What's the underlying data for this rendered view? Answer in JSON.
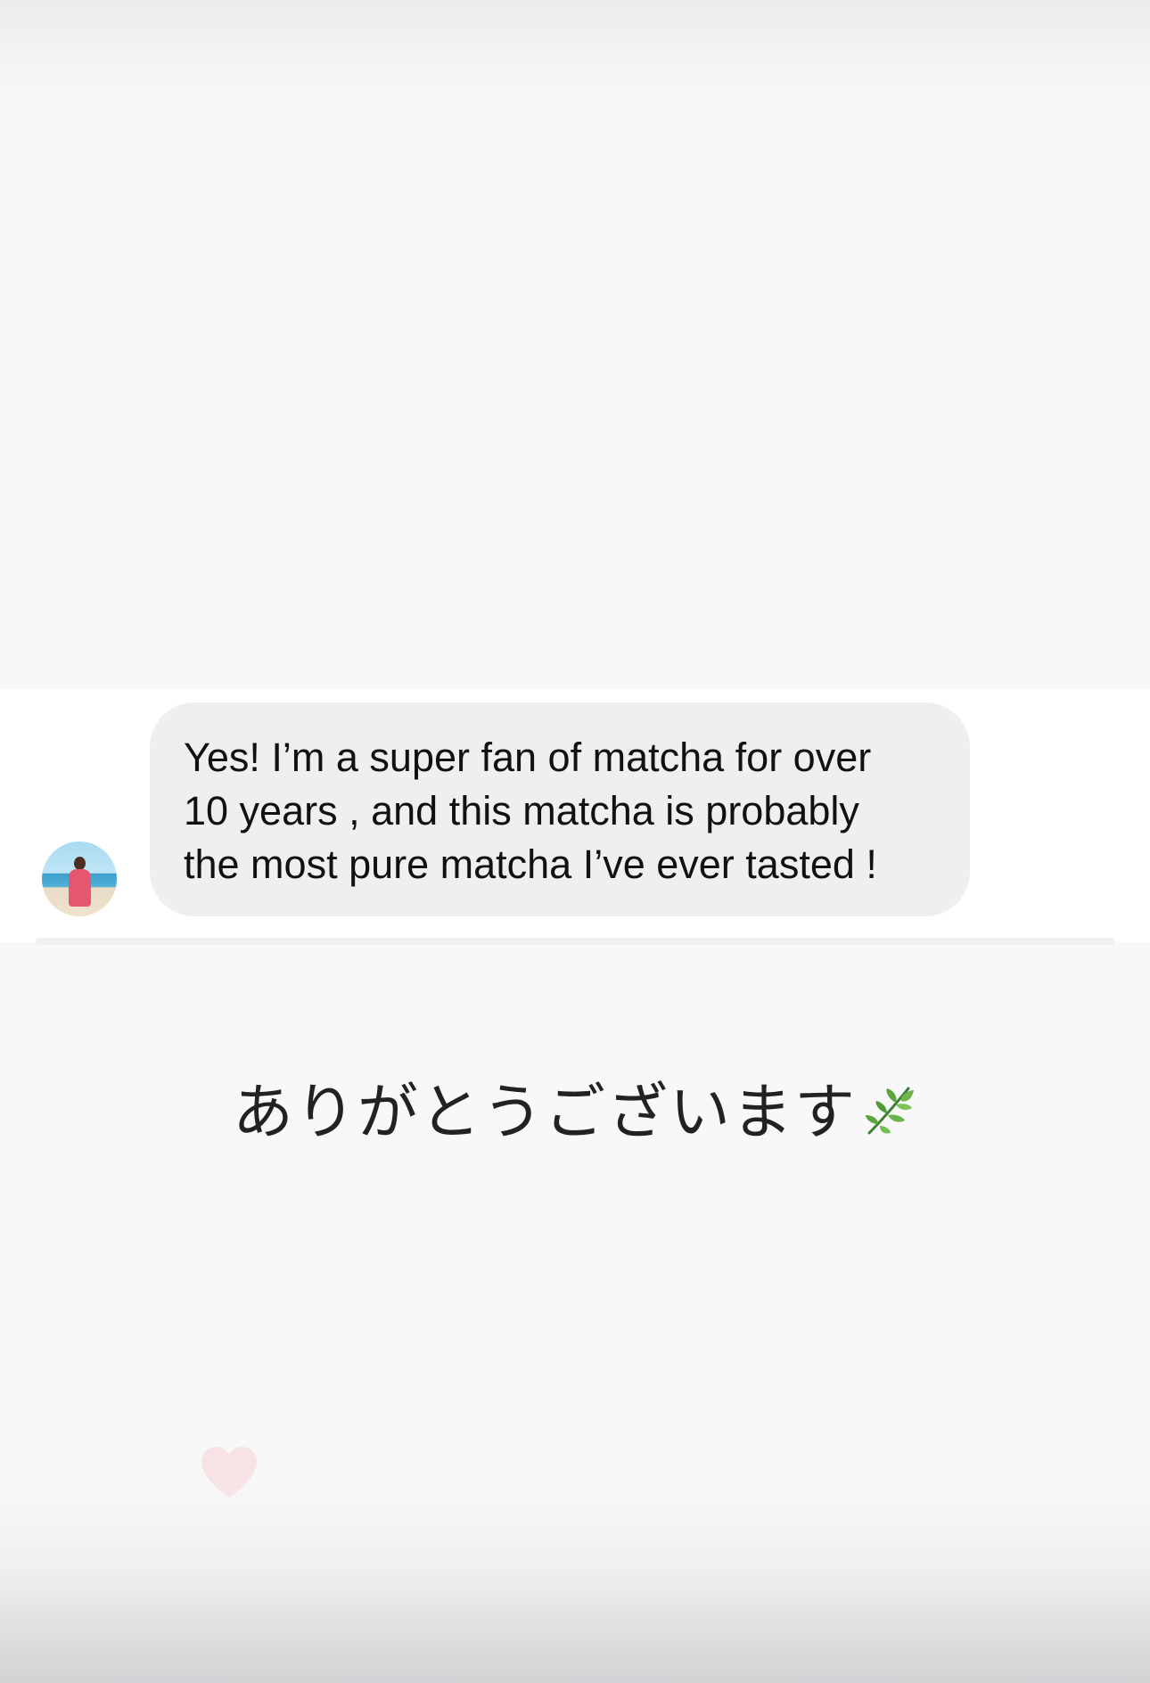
{
  "message": {
    "text": "Yes! I’m a super fan of matcha for over\n10 years , and this matcha is probably\nthe most pure matcha I’ve ever tasted !"
  },
  "caption": {
    "text": "ありがとうございます",
    "icon": "herb-leaf-icon"
  },
  "reaction": {
    "icon": "heart-icon",
    "color": "#f7e3e6"
  }
}
